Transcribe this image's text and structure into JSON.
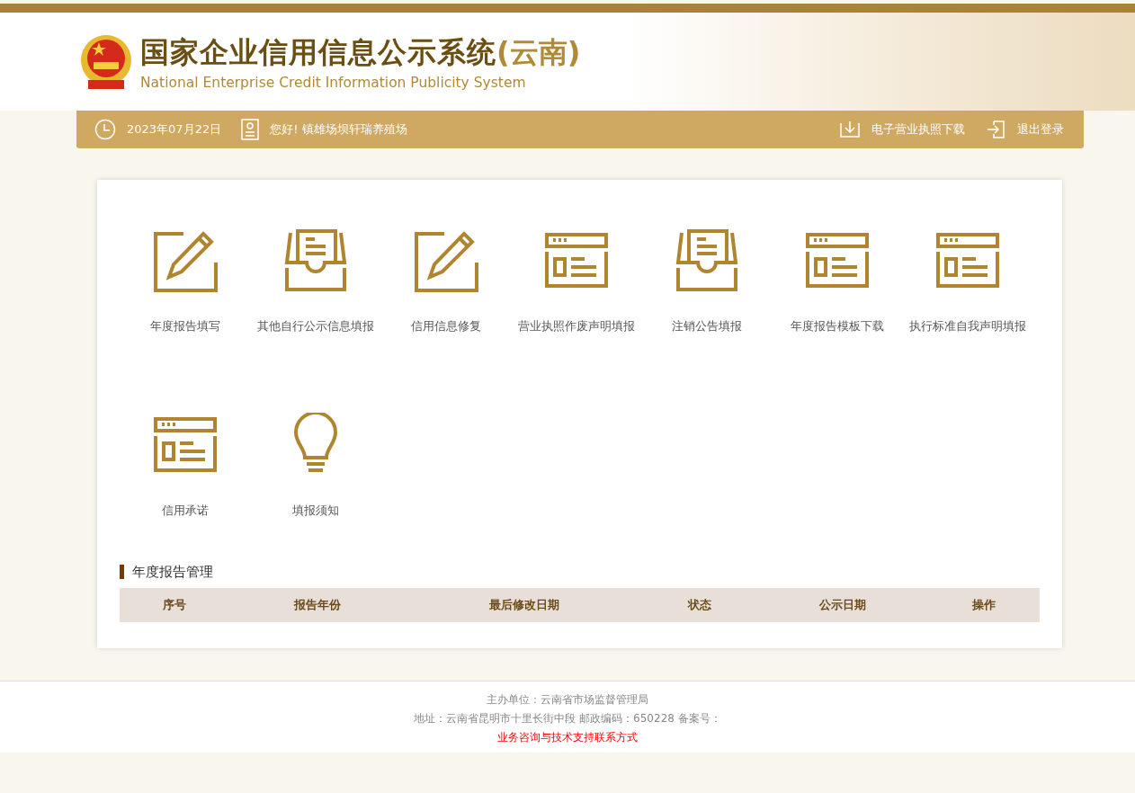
{
  "header": {
    "title": "国家企业信用信息公示系统",
    "region": "(云南)",
    "subtitle": "National Enterprise Credit Information Publicity System"
  },
  "navbar": {
    "date": "2023年07月22日",
    "greeting": "您好!  镇雄场坝轩瑞养殖场",
    "links": [
      {
        "kind": "download",
        "label": "电子营业执照下载"
      },
      {
        "kind": "logout",
        "label": "退出登录"
      }
    ]
  },
  "tiles": [
    {
      "kind": "edit",
      "label": "年度报告填写"
    },
    {
      "kind": "inbox",
      "label": "其他自行公示信息填报"
    },
    {
      "kind": "edit",
      "label": "信用信息修复"
    },
    {
      "kind": "browser",
      "label": "营业执照作废声明填报"
    },
    {
      "kind": "inbox",
      "label": "注销公告填报"
    },
    {
      "kind": "browser",
      "label": "年度报告模板下载"
    },
    {
      "kind": "browser",
      "label": "执行标准自我声明填报"
    },
    {
      "kind": "browser",
      "label": "信用承诺"
    },
    {
      "kind": "bulb",
      "label": "填报须知"
    }
  ],
  "section": {
    "title": "年度报告管理",
    "columns": [
      "序号",
      "报告年份",
      "最后修改日期",
      "状态",
      "公示日期",
      "操作"
    ]
  },
  "footer": {
    "sponsor": "主办单位：云南省市场监督管理局",
    "address": "地址：云南省昆明市十里长街中段 邮政编码：650228 备案号：",
    "contact": "业务咨询与技术支持联系方式"
  }
}
